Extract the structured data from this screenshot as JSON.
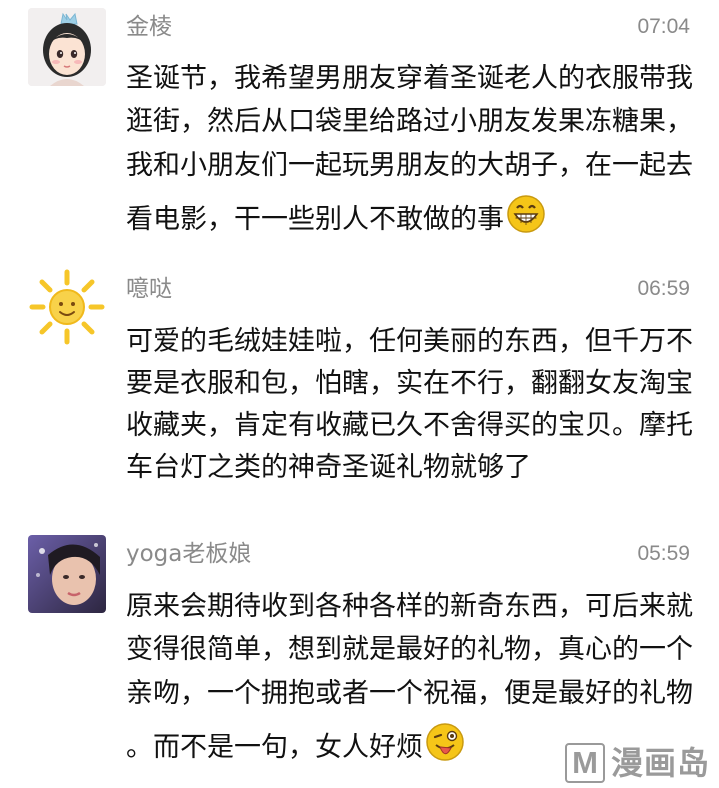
{
  "comments": [
    {
      "author": "金棱",
      "time": "07:04",
      "avatar_icon": "cartoon-girl-crown-avatar",
      "lines": [
        "圣诞节，我希望男朋友穿着圣诞老人的衣服带我",
        "逛街，然后从口袋里给路过小朋友发果冻糖果，",
        "我和小朋友们一起玩男朋友的大胡子，在一起去",
        "看电影，干一些别人不敢做的事"
      ],
      "trailing_emoji": "grinning-face-emoji"
    },
    {
      "author": "噫哒",
      "time": "06:59",
      "avatar_icon": "sun-avatar",
      "lines": [
        "可爱的毛绒娃娃啦，任何美丽的东西，但千万不",
        "要是衣服和包，怕瞎，实在不行，翻翻女友淘宝",
        "收藏夹，肯定有收藏已久不舍得买的宝贝。摩托",
        "车台灯之类的神奇圣诞礼物就够了"
      ],
      "trailing_emoji": ""
    },
    {
      "author": "yoga老板娘",
      "time": "05:59",
      "avatar_icon": "photo-woman-avatar",
      "lines": [
        "原来会期待收到各种各样的新奇东西，可后来就",
        "变得很简单，想到就是最好的礼物，真心的一个",
        "亲吻，一个拥抱或者一个祝福，便是最好的礼物",
        "。而不是一句，女人好烦"
      ],
      "trailing_emoji": "winking-tongue-face-emoji"
    }
  ],
  "watermark": {
    "letter": "M",
    "text": "漫画岛"
  },
  "colors": {
    "meta_gray": "#8a8a8a",
    "body_text": "#111111",
    "sun_yellow": "#f6c629",
    "emoji_yellow": "#f5c518"
  }
}
